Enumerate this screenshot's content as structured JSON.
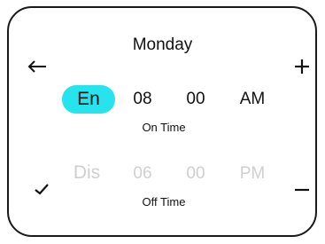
{
  "day": "Monday",
  "on": {
    "state_label": "En",
    "hour": "08",
    "minute": "00",
    "ampm": "AM",
    "caption": "On Time"
  },
  "off": {
    "state_label": "Dis",
    "hour": "06",
    "minute": "00",
    "ampm": "PM",
    "caption": "Off Time"
  },
  "icons": {
    "back": "back-arrow-icon",
    "add": "plus-icon",
    "confirm": "check-icon",
    "remove": "minus-icon"
  },
  "colors": {
    "accent": "#27e3ee",
    "disabled_text": "#cfcfcf",
    "text": "#111111",
    "border": "#1a1a1a"
  }
}
